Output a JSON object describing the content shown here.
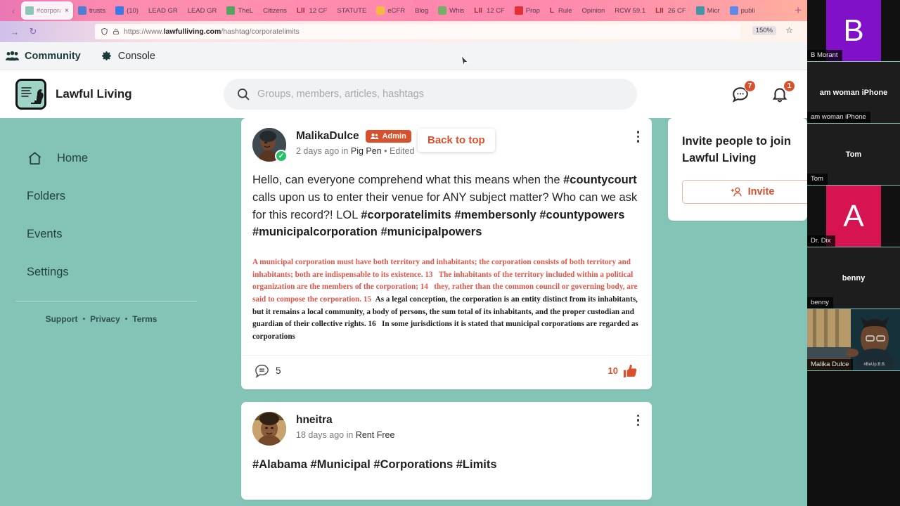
{
  "browser": {
    "back_icon": "back-arrow-icon",
    "forward_icon": "forward-arrow-icon",
    "reload_icon": "reload-icon",
    "new_tab_label": "+",
    "zoom_level": "150%",
    "star_icon": "bookmark-star-icon",
    "url": {
      "scheme": "https://www.",
      "host": "lawfulliving.com",
      "path": "/hashtag/corporatelimits",
      "shield_icon": "shield-icon",
      "lock_icon": "lock-icon"
    },
    "tabs": [
      {
        "label": "#corporatelimits",
        "favicon": "#8bc7b8",
        "active": true,
        "close_icon": "×"
      },
      {
        "label": "trusts",
        "favicon": "#2f80d8",
        "active": false
      },
      {
        "label": "(10)",
        "favicon": "#1877f2",
        "active": false
      },
      {
        "label": "LEAD GR",
        "favicon": "",
        "active": false
      },
      {
        "label": "LEAD GR",
        "favicon": "",
        "active": false
      },
      {
        "label": "TheL",
        "favicon": "#34a853",
        "active": false
      },
      {
        "label": "Citizens",
        "favicon": "",
        "active": false
      },
      {
        "label": "12 CF",
        "favicon": "",
        "active": false,
        "prefix": "LII"
      },
      {
        "label": "STATUTE",
        "favicon": "",
        "active": false
      },
      {
        "label": "eCFR",
        "favicon": "#f2c230",
        "active": false
      },
      {
        "label": "Blog",
        "favicon": "",
        "active": false
      },
      {
        "label": "Whis",
        "favicon": "#5cb85c",
        "active": false
      },
      {
        "label": "12 CF",
        "favicon": "",
        "active": false,
        "prefix": "LII"
      },
      {
        "label": "Prop",
        "favicon": "#e02020",
        "active": false
      },
      {
        "label": "Rule",
        "favicon": "",
        "active": false,
        "prefix": "L"
      },
      {
        "label": "Opinion",
        "favicon": "",
        "active": false
      },
      {
        "label": "RCW 59.1",
        "favicon": "",
        "active": false
      },
      {
        "label": "26 CF",
        "favicon": "",
        "active": false,
        "prefix": "LII"
      },
      {
        "label": "Micr",
        "favicon": "#2196a8",
        "active": false
      },
      {
        "label": "publi",
        "favicon": "#4285f4",
        "active": false
      }
    ]
  },
  "topbar": {
    "community_label": "Community",
    "community_icon": "people-group-icon",
    "console_label": "Console",
    "console_icon": "gear-icon"
  },
  "header": {
    "brand_name": "Lawful Living",
    "brand_logo_icon": "chess-knight-document-logo",
    "search_placeholder": "Groups, members, articles, hashtags",
    "search_value": "",
    "search_icon": "search-icon",
    "messages_icon": "chat-bubble-icon",
    "messages_badge": "7",
    "notifications_icon": "bell-icon",
    "notifications_badge": "1"
  },
  "sidebar": {
    "items": [
      {
        "label": "Home",
        "icon": "home-icon"
      },
      {
        "label": "Folders",
        "icon": ""
      },
      {
        "label": "Events",
        "icon": ""
      },
      {
        "label": "Settings",
        "icon": ""
      }
    ],
    "footer": {
      "support": "Support",
      "privacy": "Privacy",
      "terms": "Terms",
      "sep": "•"
    }
  },
  "feed": {
    "back_to_top_label": "Back to top",
    "posts": [
      {
        "author": "MalikaDulce",
        "badge_label": "Admin",
        "badge_icon": "people-icon",
        "verified": true,
        "time": "2 days ago",
        "in_word": "in",
        "group": "Pig Pen",
        "edited_sep": "•",
        "edited": "Edited",
        "menu_icon": "kebab-menu-icon",
        "text_parts": [
          {
            "t": "Hello, can everyone comprehend what this means when the ",
            "b": false
          },
          {
            "t": "#countycourt",
            "b": true
          },
          {
            "t": " calls upon us to enter their venue for ANY subject matter? Who can we ask for this record?! LOL ",
            "b": false
          },
          {
            "t": "#corporatelimits #membersonly #countypowers #municipalcorporation #municipalpowers",
            "b": true
          }
        ],
        "excerpt_red": "A municipal corporation must have both territory and inhabitants; the corporation consists of both territory and inhabitants; both are indispensable to its existence. 13   The inhabitants of the territory included within a political organization are the members of the corporation; 14   they, rather than the common council or governing body, are said to compose the corporation. 15  ",
        "excerpt_black": "As a legal conception, the corporation is an entity distinct from its inhabitants, but it remains a local community, a body of persons, the sum total of its inhabitants, and the proper custodian and guardian of their collective rights. 16   In some jurisdictions it is stated that municipal corporations are regarded as corporations",
        "comment_icon": "comment-bubble-icon",
        "comment_count": "5",
        "like_count": "10",
        "like_icon": "thumbs-up-icon"
      },
      {
        "author": "hneitra",
        "verified": false,
        "time": "18 days ago",
        "in_word": "in",
        "group": "Rent Free",
        "menu_icon": "kebab-menu-icon",
        "text": "#Alabama #Municipal #Corporations #Limits"
      }
    ]
  },
  "right_panel": {
    "invite_title": "Invite people to join Lawful Living",
    "invite_button_label": "Invite",
    "invite_button_icon": "add-person-icon"
  },
  "video_call": {
    "participants": [
      {
        "name": "B Morant",
        "initial": "B",
        "bg": "#8111c9",
        "type": "initial"
      },
      {
        "name": "am woman iPhone",
        "center_label": "am woman iPhone",
        "bg": "#1d1d1d",
        "type": "name"
      },
      {
        "name": "Tom",
        "center_label": "Tom",
        "bg": "#1d1d1d",
        "type": "name"
      },
      {
        "name": "Dr. Dix",
        "initial": "A",
        "bg": "#d61452",
        "type": "initial"
      },
      {
        "name": "benny",
        "center_label": "benny",
        "bg": "#1d1d1d",
        "type": "name"
      },
      {
        "name": "Malika Dulce",
        "bg": "#2d4148",
        "type": "video"
      }
    ]
  },
  "colors": {
    "page_bg": "#84c4b7",
    "accent": "#d9512c",
    "excerpt_red": "#e0564b",
    "verified_green": "#25c268"
  }
}
